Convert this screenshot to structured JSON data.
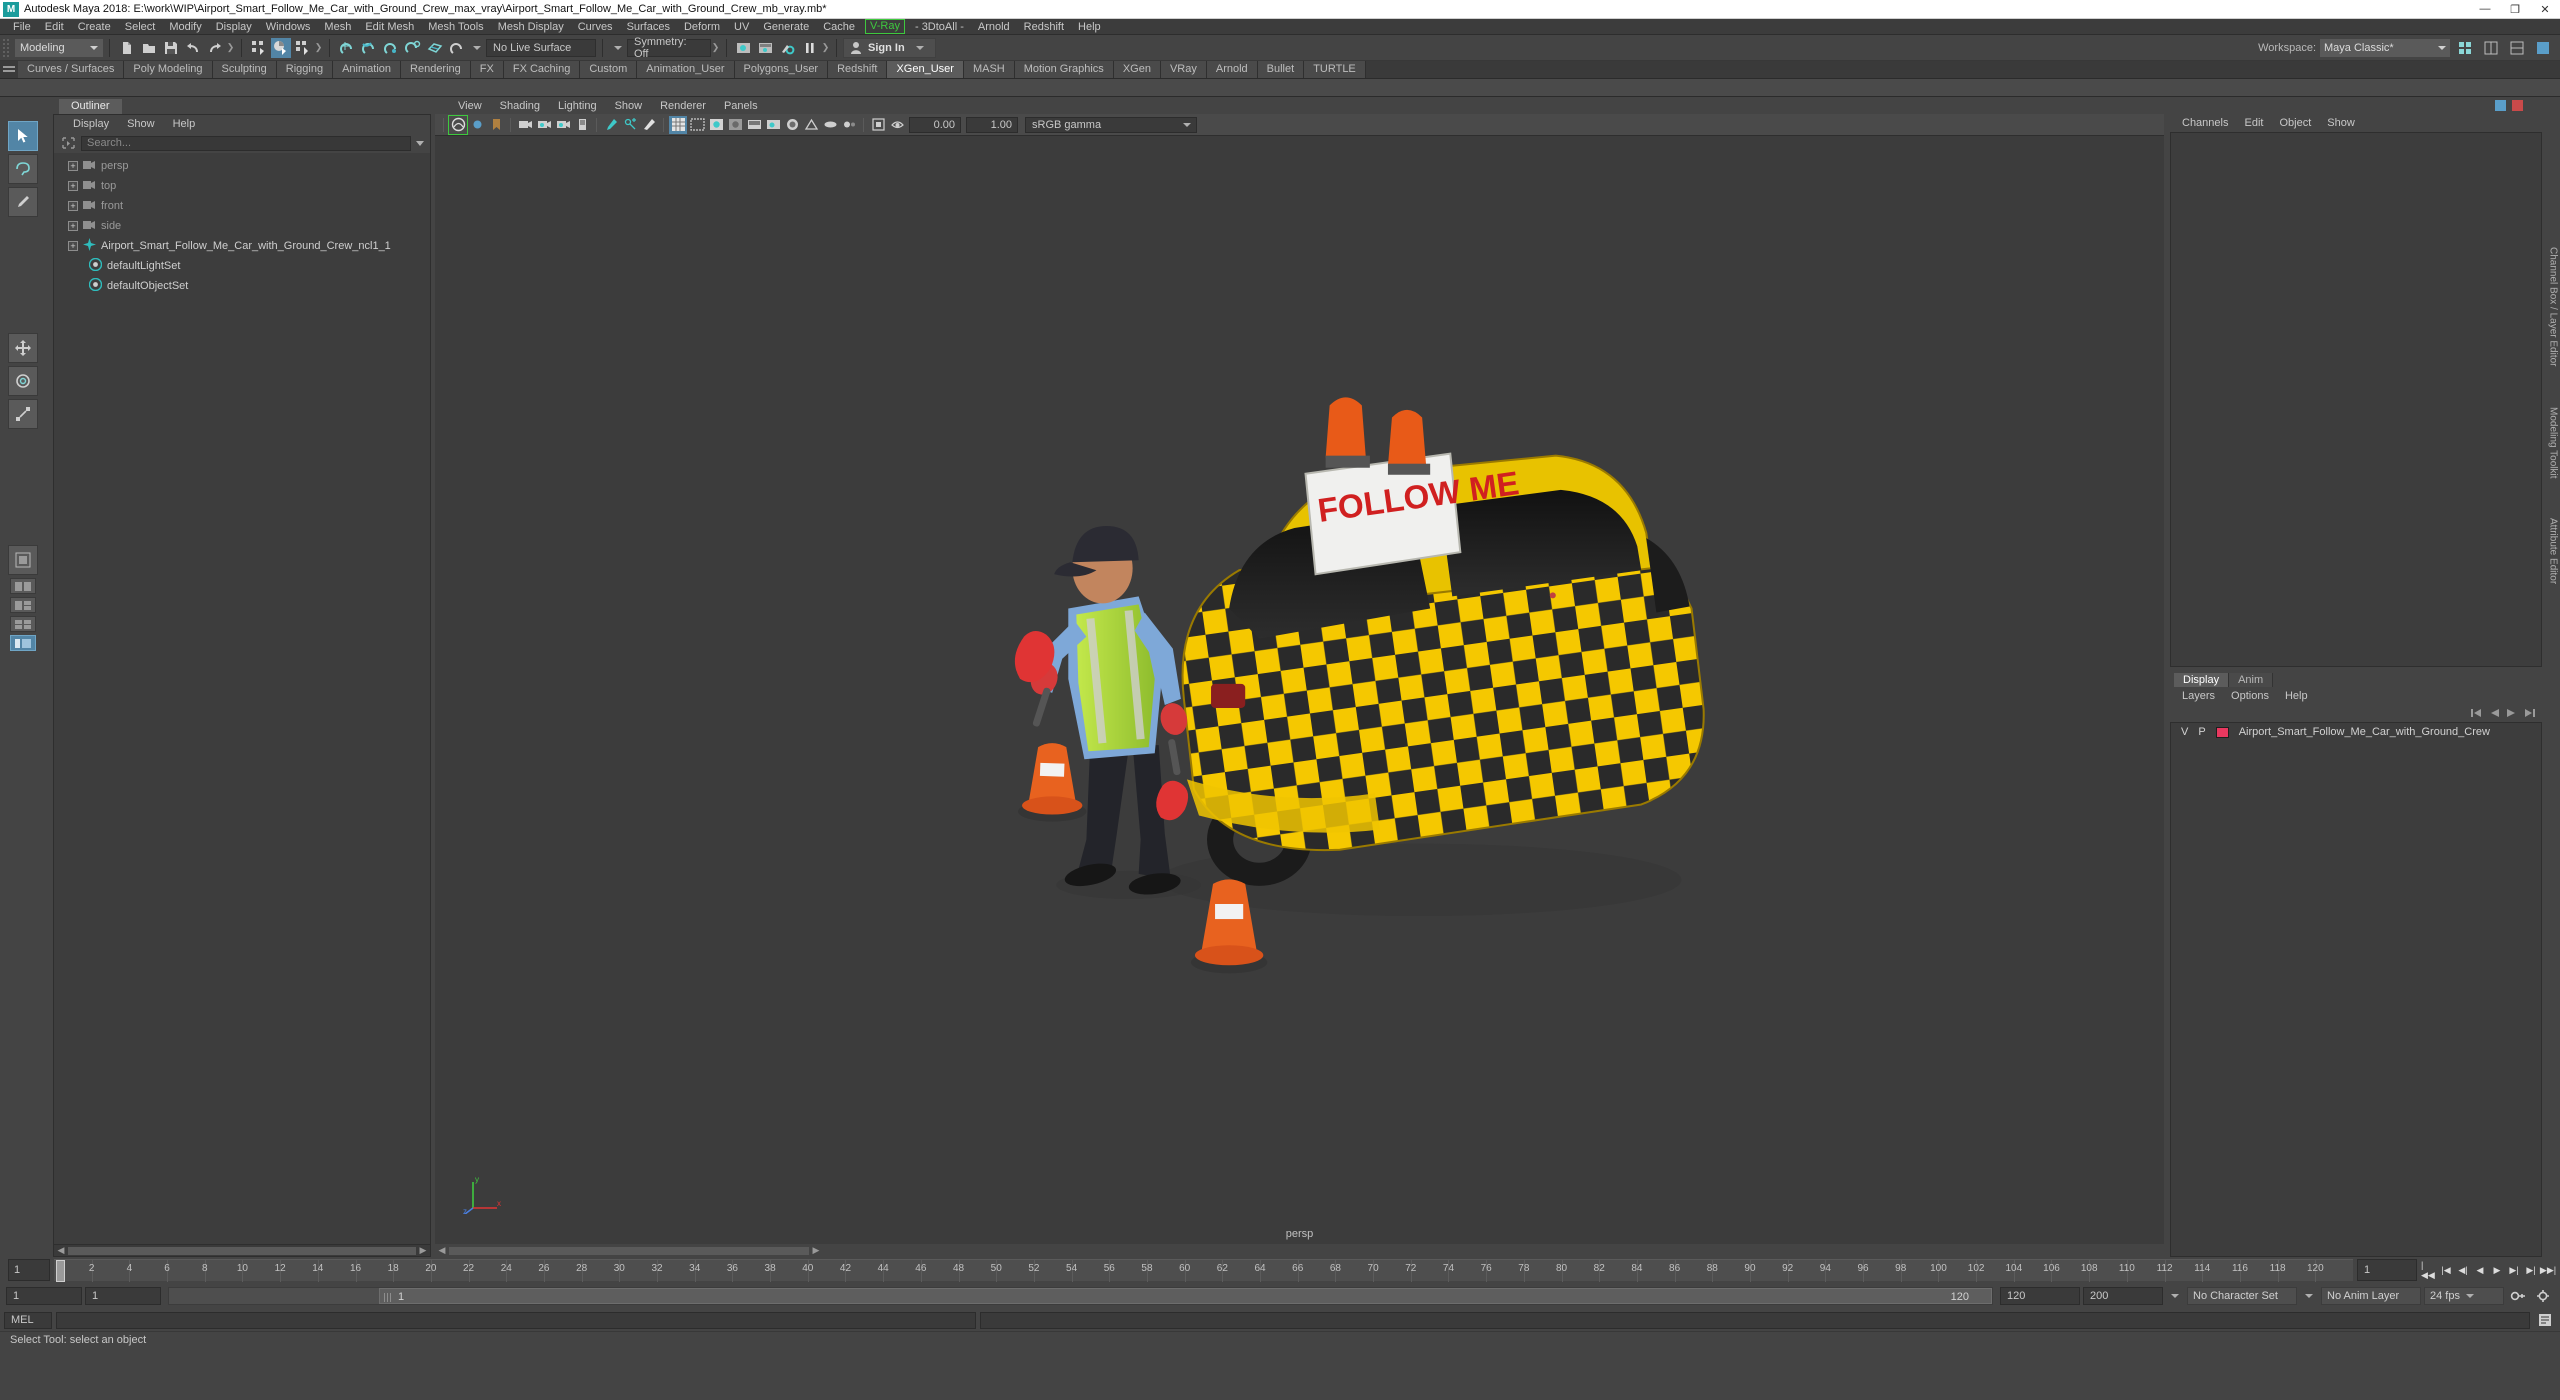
{
  "titlebar": {
    "app_icon": "maya-logo-icon",
    "title": "Autodesk Maya 2018: E:\\work\\WIP\\Airport_Smart_Follow_Me_Car_with_Ground_Crew_max_vray\\Airport_Smart_Follow_Me_Car_with_Ground_Crew_mb_vray.mb*",
    "minimize": "—",
    "maximize": "❐",
    "close": "✕"
  },
  "menubar": {
    "items": [
      {
        "label": "File",
        "style": "plain"
      },
      {
        "label": "Edit",
        "style": "plain"
      },
      {
        "label": "Create",
        "style": "plain"
      },
      {
        "label": "Select",
        "style": "plain"
      },
      {
        "label": "Modify",
        "style": "plain"
      },
      {
        "label": "Display",
        "style": "plain"
      },
      {
        "label": "Windows",
        "style": "plain"
      },
      {
        "label": "Mesh",
        "style": "plain"
      },
      {
        "label": "Edit Mesh",
        "style": "plain"
      },
      {
        "label": "Mesh Tools",
        "style": "plain"
      },
      {
        "label": "Mesh Display",
        "style": "plain"
      },
      {
        "label": "Curves",
        "style": "plain"
      },
      {
        "label": "Surfaces",
        "style": "plain"
      },
      {
        "label": "Deform",
        "style": "plain"
      },
      {
        "label": "UV",
        "style": "plain"
      },
      {
        "label": "Generate",
        "style": "plain"
      },
      {
        "label": "Cache",
        "style": "plain"
      },
      {
        "label": "V-Ray",
        "style": "vray"
      },
      {
        "label": "- 3DtoAll -",
        "style": "plain"
      },
      {
        "label": "Arnold",
        "style": "plain"
      },
      {
        "label": "Redshift",
        "style": "plain"
      },
      {
        "label": "Help",
        "style": "plain"
      }
    ]
  },
  "statusbar": {
    "mode": "Modeling",
    "live_surface": "No Live Surface",
    "symmetry": "Symmetry: Off",
    "signin": "Sign In",
    "workspace_label": "Workspace:",
    "workspace_value": "Maya Classic*"
  },
  "shelf": {
    "tabs": [
      {
        "label": "Curves / Surfaces",
        "active": false
      },
      {
        "label": "Poly Modeling",
        "active": false
      },
      {
        "label": "Sculpting",
        "active": false
      },
      {
        "label": "Rigging",
        "active": false
      },
      {
        "label": "Animation",
        "active": false
      },
      {
        "label": "Rendering",
        "active": false
      },
      {
        "label": "FX",
        "active": false
      },
      {
        "label": "FX Caching",
        "active": false
      },
      {
        "label": "Custom",
        "active": false
      },
      {
        "label": "Animation_User",
        "active": false
      },
      {
        "label": "Polygons_User",
        "active": false
      },
      {
        "label": "Redshift",
        "active": false
      },
      {
        "label": "XGen_User",
        "active": true
      },
      {
        "label": "MASH",
        "active": false
      },
      {
        "label": "Motion Graphics",
        "active": false
      },
      {
        "label": "XGen",
        "active": false
      },
      {
        "label": "VRay",
        "active": false
      },
      {
        "label": "Arnold",
        "active": false
      },
      {
        "label": "Bullet",
        "active": false
      },
      {
        "label": "TURTLE",
        "active": false
      }
    ]
  },
  "outliner": {
    "tab": "Outliner",
    "menu": [
      "Display",
      "Show",
      "Help"
    ],
    "search_placeholder": "Search...",
    "items": [
      {
        "label": "persp",
        "icon": "camera-icon",
        "expandable": true,
        "dim": true,
        "indent": 0
      },
      {
        "label": "top",
        "icon": "camera-icon",
        "expandable": true,
        "dim": true,
        "indent": 0
      },
      {
        "label": "front",
        "icon": "camera-icon",
        "expandable": true,
        "dim": true,
        "indent": 0
      },
      {
        "label": "side",
        "icon": "camera-icon",
        "expandable": true,
        "dim": true,
        "indent": 0
      },
      {
        "label": "Airport_Smart_Follow_Me_Car_with_Ground_Crew_ncl1_1",
        "icon": "transform-icon",
        "expandable": true,
        "dim": false,
        "indent": 0
      },
      {
        "label": "defaultLightSet",
        "icon": "set-icon",
        "expandable": false,
        "dim": false,
        "indent": 1
      },
      {
        "label": "defaultObjectSet",
        "icon": "set-icon",
        "expandable": false,
        "dim": false,
        "indent": 1
      }
    ]
  },
  "viewport": {
    "menu": [
      "View",
      "Shading",
      "Lighting",
      "Show",
      "Renderer",
      "Panels"
    ],
    "exposure": "0.00",
    "gamma": "1.00",
    "color_space": "sRGB gamma",
    "camera_label": "persp",
    "axis": {
      "x": "x",
      "y": "y",
      "z": "z"
    },
    "scene_text": "FOLLOW ME"
  },
  "right_panel": {
    "channels_menu": [
      "Channels",
      "Edit",
      "Object",
      "Show"
    ],
    "display_tabs": [
      {
        "label": "Display",
        "active": true
      },
      {
        "label": "Anim",
        "active": false
      }
    ],
    "layers_menu": [
      "Layers",
      "Options",
      "Help"
    ],
    "column_v": "V",
    "column_p": "P",
    "layer_name": "Airport_Smart_Follow_Me_Car_with_Ground_Crew",
    "layer_color": "#e8385f",
    "sidebar_labels": [
      "Channel Box / Layer Editor",
      "Modeling Toolkit",
      "Attribute Editor"
    ]
  },
  "timeline": {
    "current_frame_left": "1",
    "current_frame_right": "1",
    "ticks": [
      "2",
      "4",
      "6",
      "8",
      "10",
      "12",
      "14",
      "16",
      "18",
      "20",
      "22",
      "24",
      "26",
      "28",
      "30",
      "32",
      "34",
      "36",
      "38",
      "40",
      "42",
      "44",
      "46",
      "48",
      "50",
      "52",
      "54",
      "56",
      "58",
      "60",
      "62",
      "64",
      "66",
      "68",
      "70",
      "72",
      "74",
      "76",
      "78",
      "80",
      "82",
      "84",
      "86",
      "88",
      "90",
      "92",
      "94",
      "96",
      "98",
      "100",
      "102",
      "104",
      "106",
      "108",
      "110",
      "112",
      "114",
      "116",
      "118",
      "120"
    ],
    "buttons": [
      "|◀◀",
      "|◀",
      "◀|",
      "◀",
      "▶",
      "▶|",
      "▶|",
      "▶▶|"
    ]
  },
  "range": {
    "start": "1",
    "range_start": "1",
    "range_end": "120",
    "playback_end": "120",
    "anim_end": "200",
    "character_set": "No Character Set",
    "anim_layer": "No Anim Layer",
    "fps": "24 fps"
  },
  "command": {
    "language": "MEL",
    "input_value": "",
    "output_value": ""
  },
  "helpline": {
    "text": "Select Tool: select an object"
  }
}
